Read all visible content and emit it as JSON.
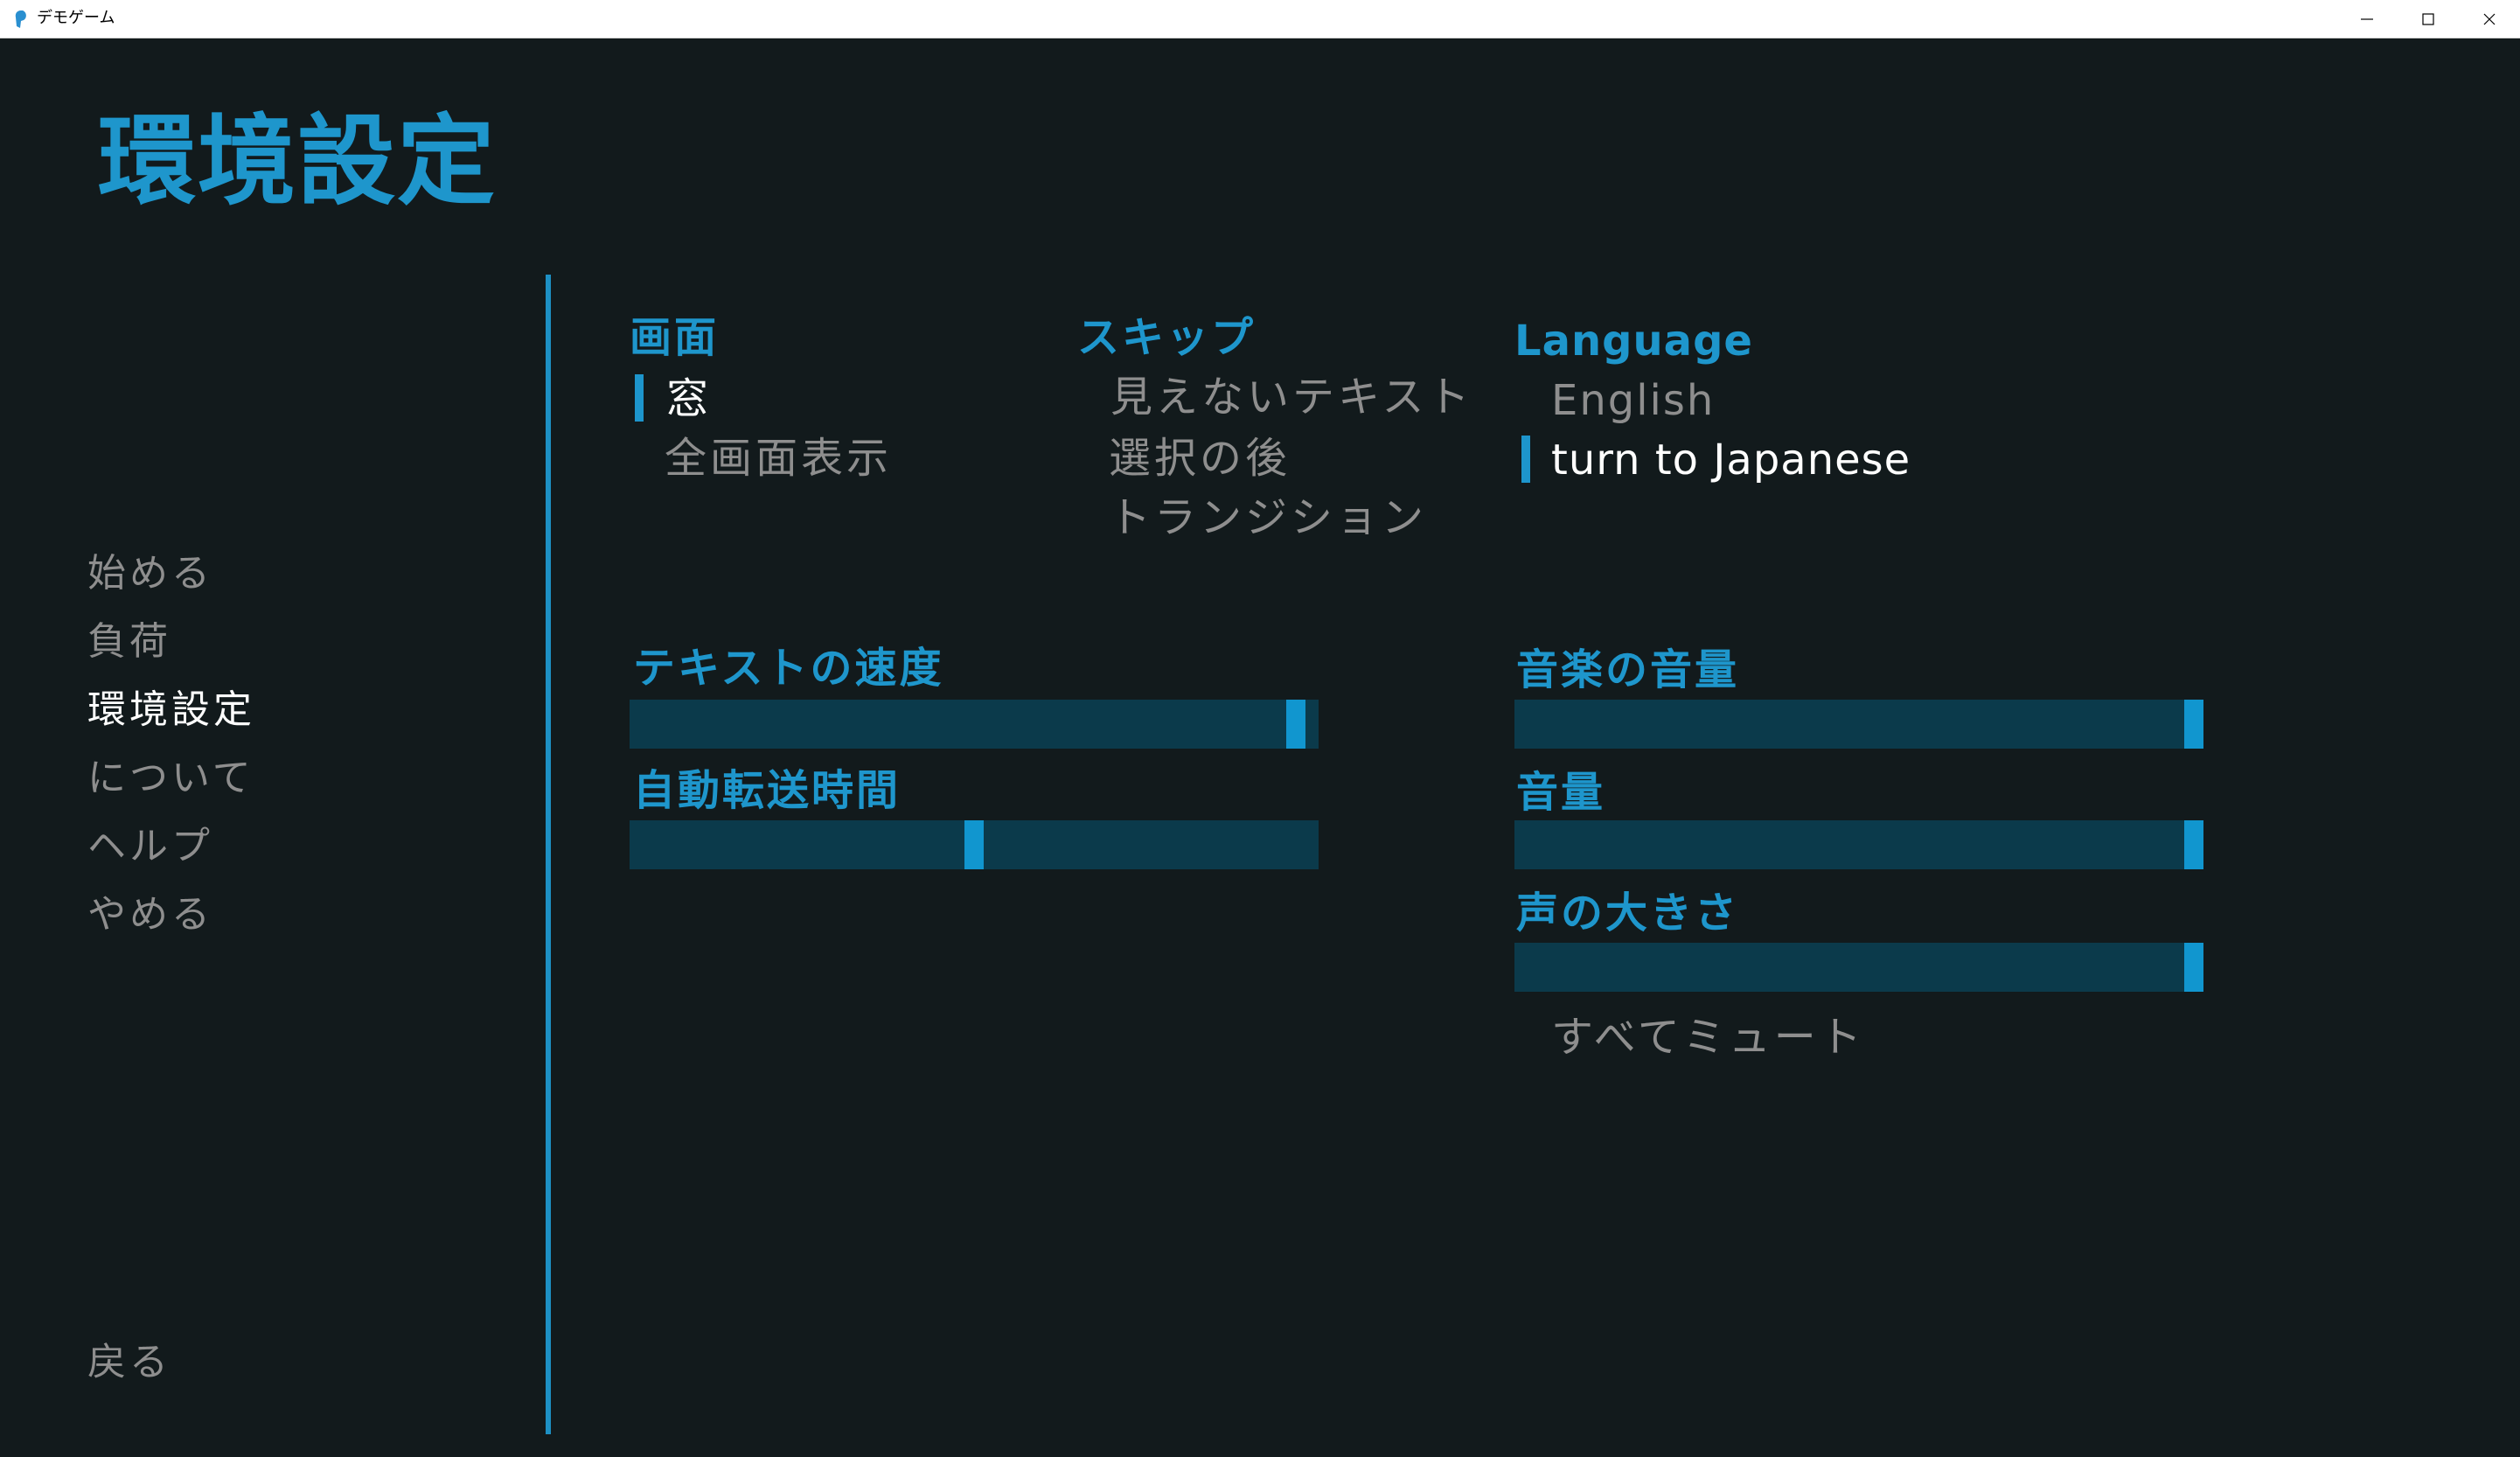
{
  "window": {
    "title": "デモゲーム",
    "minimize_glyph": "─",
    "maximize_glyph": "☐",
    "close_glyph": "✕"
  },
  "page_title": "環境設定",
  "nav": {
    "items": [
      {
        "label": "始める",
        "active": false
      },
      {
        "label": "負荷",
        "active": false
      },
      {
        "label": "環境設定",
        "active": true
      },
      {
        "label": "について",
        "active": false
      },
      {
        "label": "ヘルプ",
        "active": false
      },
      {
        "label": "やめる",
        "active": false
      }
    ],
    "back_label": "戻る"
  },
  "display": {
    "heading": "画面",
    "options": [
      {
        "label": "窓",
        "selected": true
      },
      {
        "label": "全画面表示",
        "selected": false
      }
    ]
  },
  "skip": {
    "heading": "スキップ",
    "options": [
      {
        "label": "見えないテキスト",
        "selected": false
      },
      {
        "label": "選択の後",
        "selected": false
      },
      {
        "label": "トランジション",
        "selected": false
      }
    ]
  },
  "language": {
    "heading": "Language",
    "options": [
      {
        "label": "English",
        "selected": false
      },
      {
        "label": "turn to Japanese",
        "selected": true
      }
    ]
  },
  "sliders": {
    "text_speed": {
      "label": "テキストの速度",
      "value": 0.98
    },
    "auto_forward": {
      "label": "自動転送時間",
      "value": 0.5
    },
    "music_volume": {
      "label": "音楽の音量",
      "value": 1.0
    },
    "sound_volume": {
      "label": "音量",
      "value": 1.0
    },
    "voice_volume": {
      "label": "声の大きさ",
      "value": 1.0
    }
  },
  "mute_all_label": "すべてミュート",
  "colors": {
    "accent": "#1e96cc",
    "background": "#121a1c",
    "slider_track": "#0b3a4b",
    "text_idle": "#8e8e8e",
    "text_selected": "#ffffff"
  }
}
